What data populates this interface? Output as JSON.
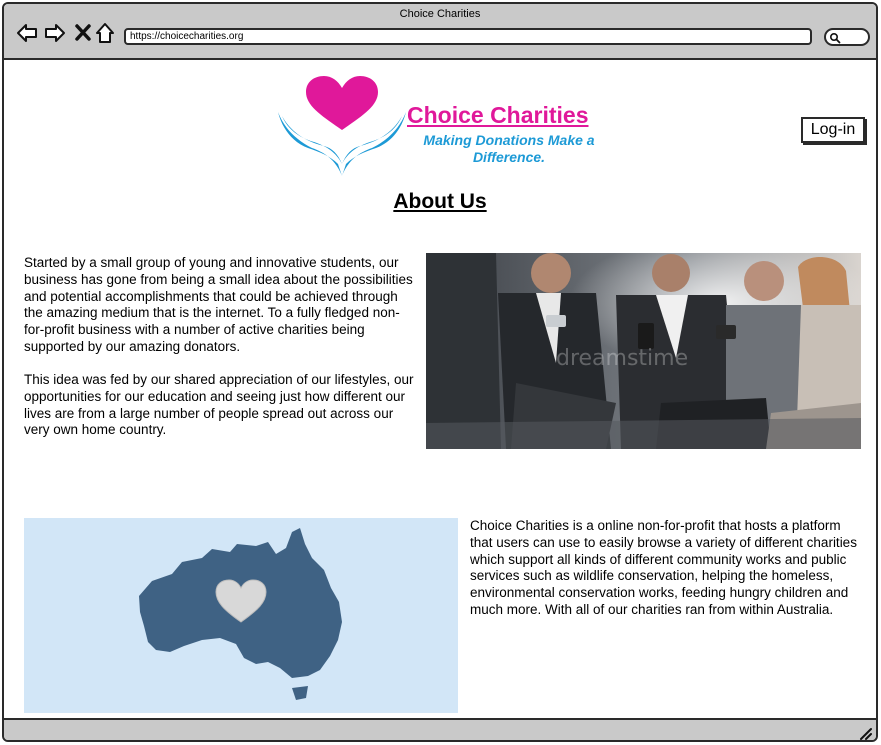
{
  "window": {
    "title": "Choice Charities",
    "url": "https://choicecharities.org"
  },
  "header": {
    "logo_name": "Choice Charities",
    "logo_tagline": "Making Donations Make a Difference.",
    "login_label": "Log-in"
  },
  "main": {
    "heading": "About Us",
    "paragraph1": "Started by a small group of young and innovative students, our business has gone from being a small idea about the possibilities and potential accomplishments that could be achieved through the amazing medium that is the internet. To a fully fledged non-for-profit business with a number of active charities being supported by our amazing donators.",
    "paragraph2": "This idea was fed by our shared appreciation of our lifestyles, our opportunities for our education and seeing just how different our lives are from a large number of people spread out across our very own home country.",
    "paragraph3": "Choice Charities is a online non-for-profit that hosts a platform that users can use to easily browse a variety of different charities which support all kinds of different community works and public services such as wildlife conservation, helping the homeless, environmental conservation works, feeding hungry children and much more. With all of our charities ran from within Australia.",
    "photo_watermark": "dreamstime"
  },
  "colors": {
    "brand_pink": "#e0189a",
    "brand_blue": "#1d9ad6",
    "map_background": "#d2e6f7",
    "map_land": "#3f6284",
    "chrome_gray": "#c9c9c9"
  },
  "icons": {
    "back": "back-arrow-icon",
    "forward": "forward-arrow-icon",
    "stop": "close-icon",
    "home": "home-icon",
    "search": "search-icon",
    "resize": "resize-grip-icon"
  }
}
